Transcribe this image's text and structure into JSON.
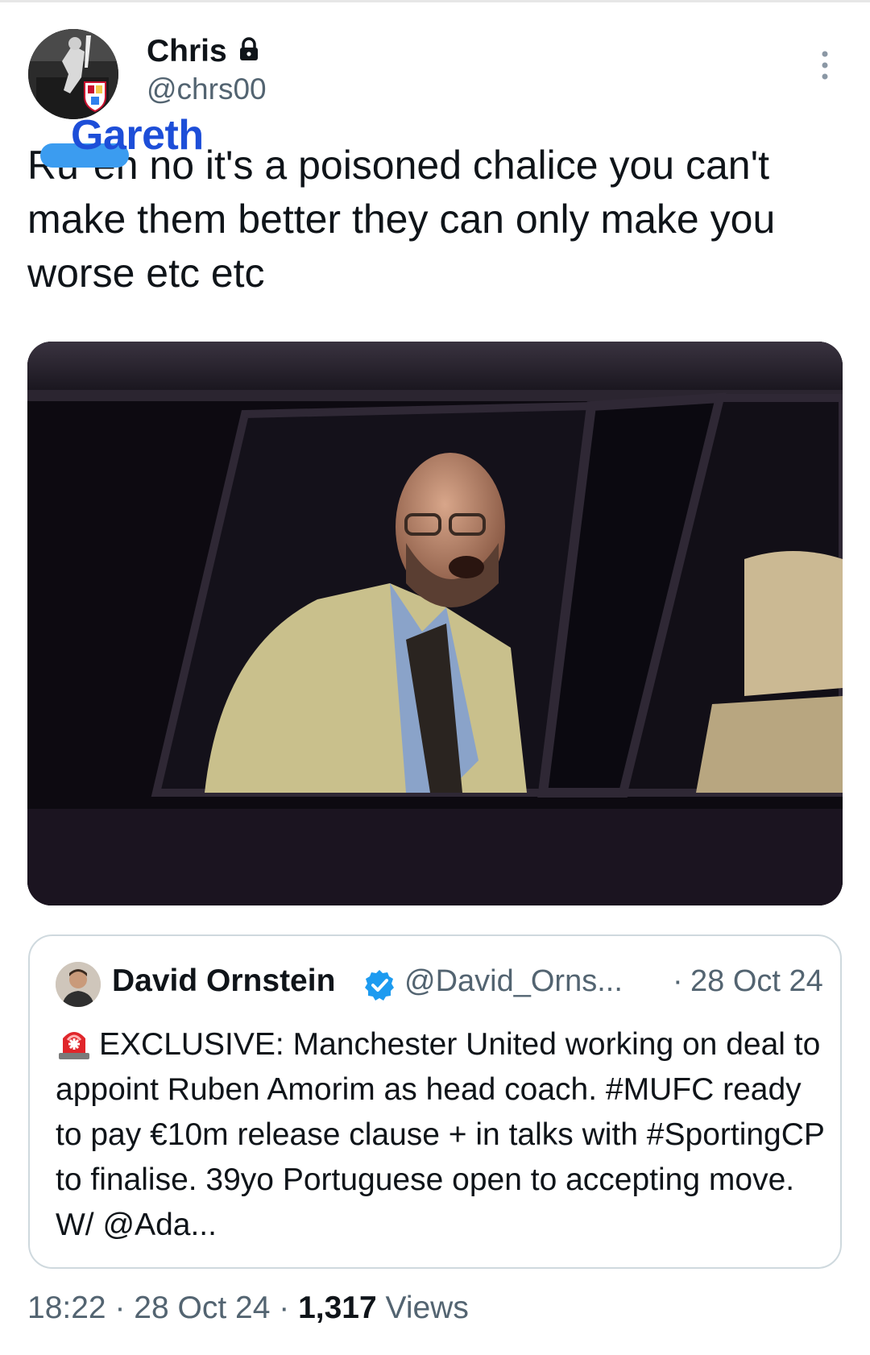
{
  "author": {
    "name": "Chris",
    "handle": "@chrs00",
    "protected_icon": "lock-icon"
  },
  "tweet": {
    "overlay_name": "Gareth",
    "text": "Ruben no it's a poisoned chalice you can't make them better they can only make you worse etc etc",
    "text_prefix": "Ru",
    "text_rest": "en no it's a poisoned chalice you can't make them better they can only make you worse etc etc"
  },
  "quoted_tweet": {
    "name": "David Ornstein",
    "verified_icon": "verified-badge-icon",
    "handle": "@David_Orns...",
    "separator": "·",
    "date": "28 Oct 24",
    "emoji_icon": "siren-icon",
    "text": "EXCLUSIVE: Manchester United working on deal to appoint Ruben Amorim as head coach. #MUFC ready to pay €10m release clause + in talks with #SportingCP to finalise. 39yo Portuguese open to accepting move. W/ @Ada..."
  },
  "meta": {
    "time": "18:22",
    "sep1": " · ",
    "date": "28 Oct 24",
    "sep2": " · ",
    "views_count": "1,317",
    "views_label": " Views"
  },
  "colors": {
    "text": "#0f1419",
    "secondary": "#536471",
    "border": "#cfd9de",
    "overlay_blue": "#1d4ed8",
    "verified_blue": "#1d9bf0"
  }
}
